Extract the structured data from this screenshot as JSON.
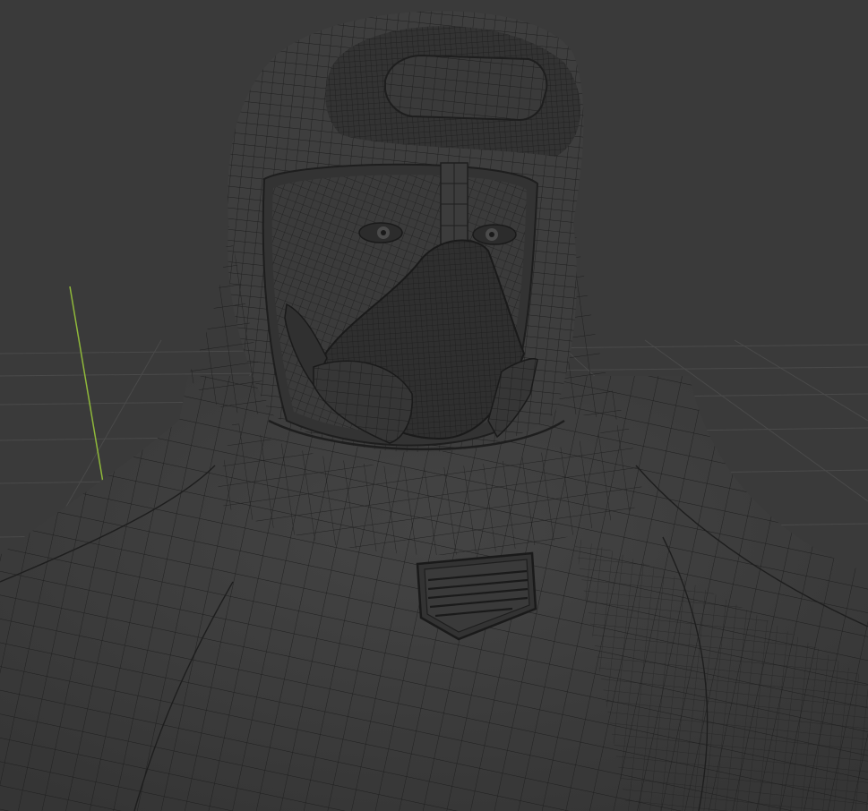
{
  "viewport": {
    "mode": "3d-viewport-wireframe-overlay",
    "subject": "hooded-hazmat-figure-bust",
    "visible_overlays": [
      "floor-grid",
      "y-axis-line"
    ]
  },
  "colors": {
    "background": "#3a3a3a",
    "floor_grid": "#4a4a4a",
    "y_axis": "#8fb83a",
    "mesh_fill": "#3d3d3d",
    "mesh_shadow": "#333333",
    "wire": "#1e1e1e"
  }
}
